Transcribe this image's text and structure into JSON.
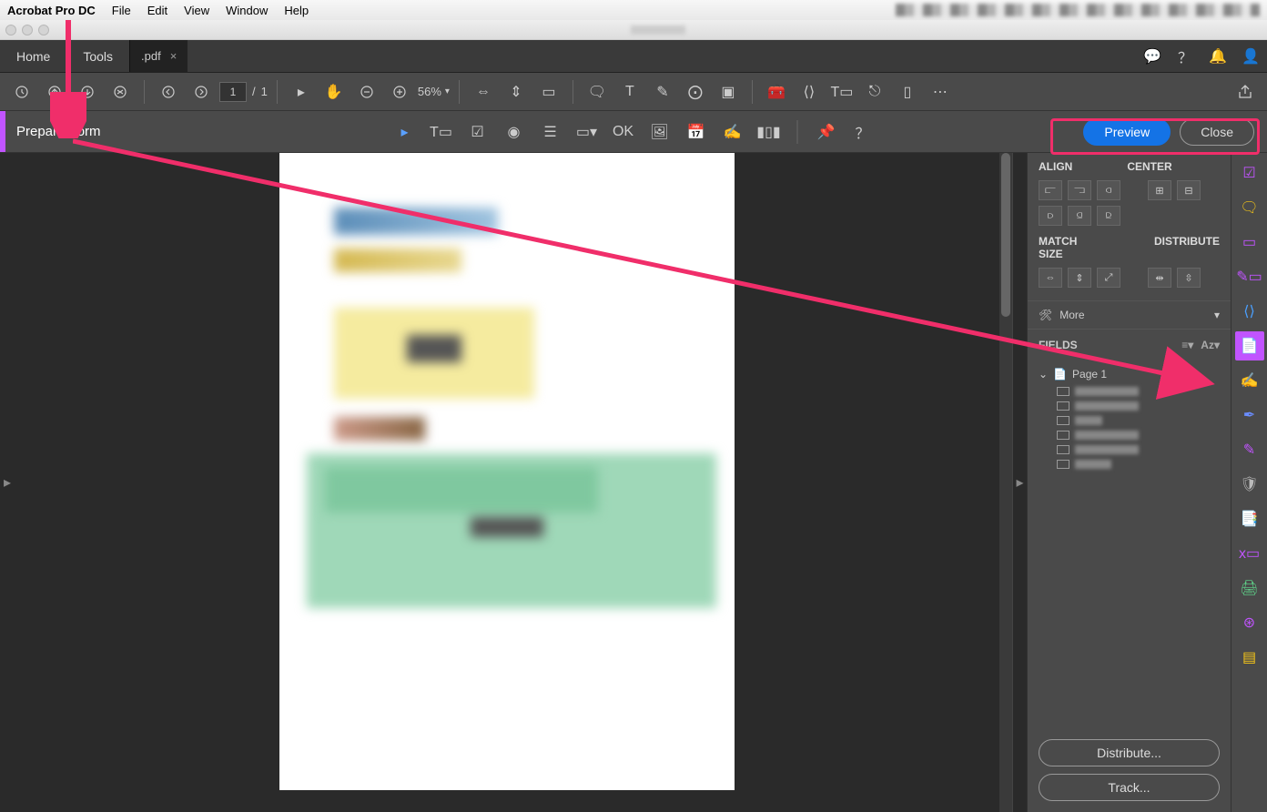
{
  "menubar": {
    "app_name": "Acrobat Pro DC",
    "items": [
      "File",
      "Edit",
      "View",
      "Window",
      "Help"
    ]
  },
  "tabs": {
    "home": "Home",
    "tools": "Tools",
    "document": ".pdf"
  },
  "toolbar": {
    "page_current": "1",
    "page_sep": "/",
    "page_total": "1",
    "zoom": "56%"
  },
  "form_toolbar": {
    "label": "Prepare Form",
    "preview": "Preview",
    "close": "Close"
  },
  "right_panel": {
    "align": "ALIGN",
    "center": "CENTER",
    "match_size": "MATCH SIZE",
    "distribute": "DISTRIBUTE",
    "more": "More",
    "fields": "FIELDS",
    "page1": "Page 1",
    "distribute_btn": "Distribute...",
    "track_btn": "Track..."
  }
}
